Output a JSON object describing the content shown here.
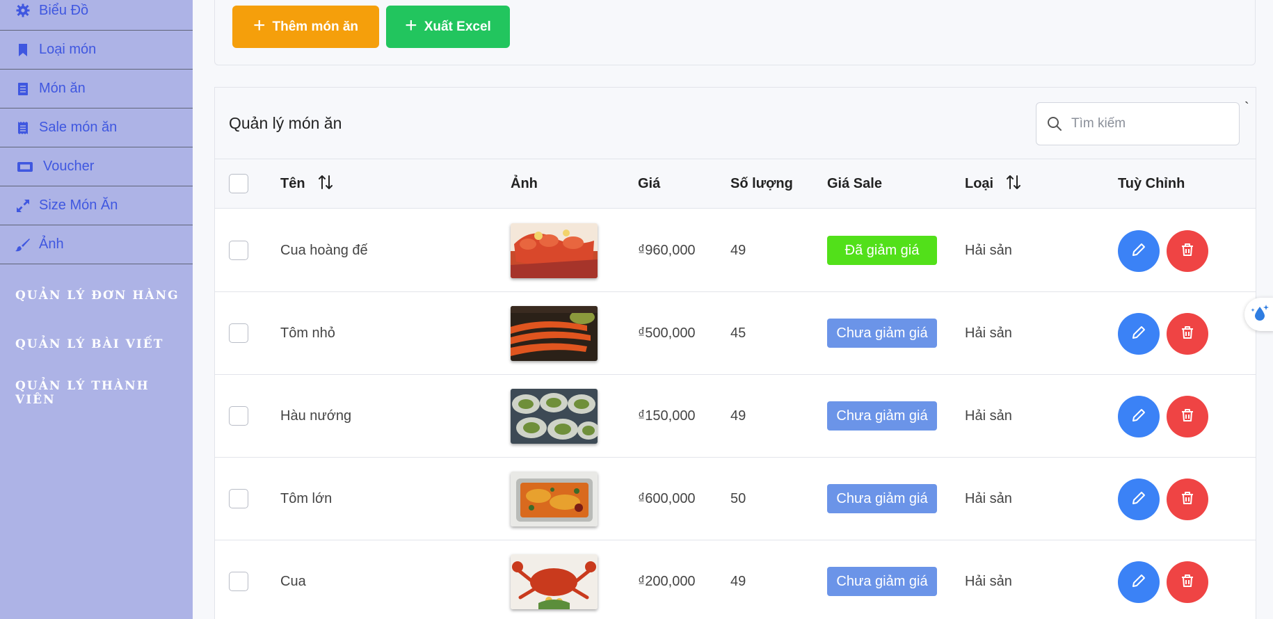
{
  "sidebar": {
    "items": [
      {
        "label": "Biểu Đồ",
        "icon": "gear-icon"
      },
      {
        "label": "Loại món",
        "icon": "bookmark-icon"
      },
      {
        "label": "Món ăn",
        "icon": "document-icon"
      },
      {
        "label": "Sale món ăn",
        "icon": "receipt-icon"
      },
      {
        "label": "Voucher",
        "icon": "ticket-icon"
      },
      {
        "label": "Size Món Ăn",
        "icon": "expand-icon"
      },
      {
        "label": "Ảnh",
        "icon": "brush-icon"
      }
    ],
    "sections": [
      {
        "label": "QUẢN LÝ ĐƠN HÀNG"
      },
      {
        "label": "QUẢN LÝ BÀI VIẾT"
      },
      {
        "label": "QUẢN LÝ THÀNH VIÊN"
      }
    ]
  },
  "toolbar": {
    "add_label": "Thêm món ăn",
    "excel_label": "Xuất Excel"
  },
  "table": {
    "title": "Quản lý món ăn",
    "search_placeholder": "Tìm kiếm",
    "backtick": "`",
    "columns": {
      "name": "Tên",
      "image": "Ảnh",
      "price": "Giá",
      "quantity": "Số lượng",
      "sale": "Giá Sale",
      "category": "Loại",
      "actions": "Tuỳ Chỉnh"
    },
    "rows": [
      {
        "name": "Cua hoàng đế",
        "image": "king-crab-photo",
        "price": "₫960,000",
        "quantity": "49",
        "sale": "Đã giảm giá",
        "sale_color": "#52e01a",
        "category": "Hải sản"
      },
      {
        "name": "Tôm nhỏ",
        "image": "grilled-shrimp-photo",
        "price": "₫500,000",
        "quantity": "45",
        "sale": "Chưa giảm giá",
        "sale_color": "#6b94e8",
        "category": "Hải sản"
      },
      {
        "name": "Hàu nướng",
        "image": "grilled-oyster-photo",
        "price": "₫150,000",
        "quantity": "49",
        "sale": "Chưa giảm giá",
        "sale_color": "#6b94e8",
        "category": "Hải sản"
      },
      {
        "name": "Tôm lớn",
        "image": "lobster-tray-photo",
        "price": "₫600,000",
        "quantity": "50",
        "sale": "Chưa giảm giá",
        "sale_color": "#6b94e8",
        "category": "Hải sản"
      },
      {
        "name": "Cua",
        "image": "crab-photo",
        "price": "₫200,000",
        "quantity": "49",
        "sale": "Chưa giảm giá",
        "sale_color": "#6b94e8",
        "category": "Hải sản"
      }
    ]
  },
  "colors": {
    "sidebar_bg": "#adb3e6",
    "sidebar_link": "#3f57e0",
    "add_button": "#f59f0b",
    "excel_button": "#22c55e",
    "edit_button": "#3b82f6",
    "delete_button": "#ef4444"
  }
}
